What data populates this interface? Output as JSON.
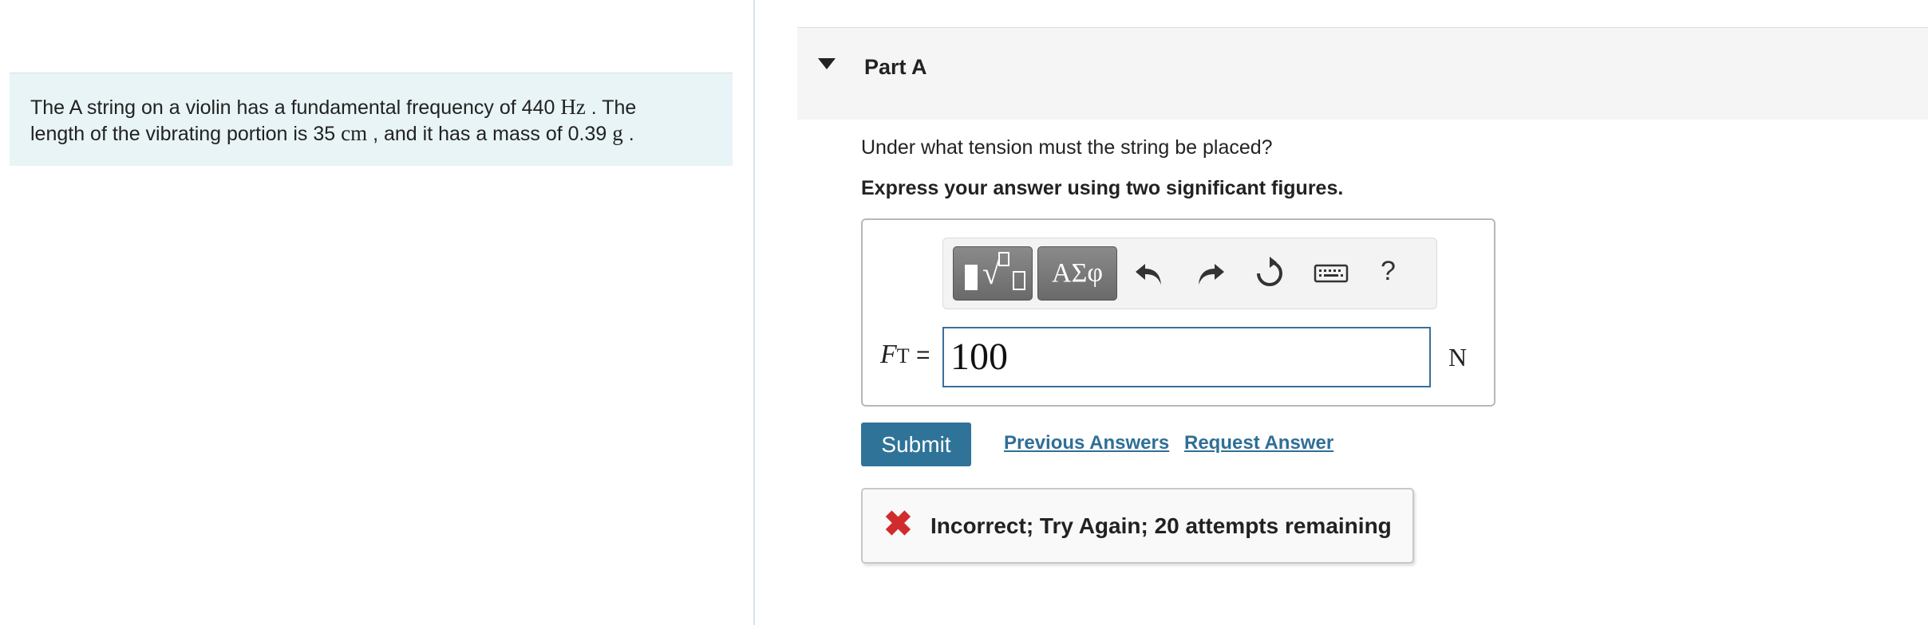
{
  "problem": {
    "line1_pre": "The A string on a violin has a fundamental frequency of 440 ",
    "line1_unit": "Hz",
    "line1_post": " . The",
    "line2_pre": "length of the vibrating portion is 35 ",
    "line2_unit1": "cm",
    "line2_mid": " , and it has a mass of 0.39 ",
    "line2_unit2": "g",
    "line2_post": " ."
  },
  "part": {
    "title": "Part A",
    "question": "Under what tension must the string be placed?",
    "instruction": "Express your answer using two significant figures."
  },
  "toolbar": {
    "greek_label": "ΑΣφ",
    "help_label": "?"
  },
  "answer": {
    "var_symbol": "F",
    "var_subscript": "T",
    "equals": " =",
    "value": "100",
    "unit": "N"
  },
  "actions": {
    "submit_label": "Submit",
    "previous_answers_label": "Previous Answers",
    "request_answer_label": "Request Answer"
  },
  "feedback": {
    "icon": "✖",
    "message": "Incorrect; Try Again; 20 attempts remaining"
  },
  "colors": {
    "problem_bg": "#e8f4f6",
    "submit_bg": "#2f7399",
    "link": "#2f6f96",
    "error": "#d12b2b",
    "input_border": "#3a6f9e"
  }
}
